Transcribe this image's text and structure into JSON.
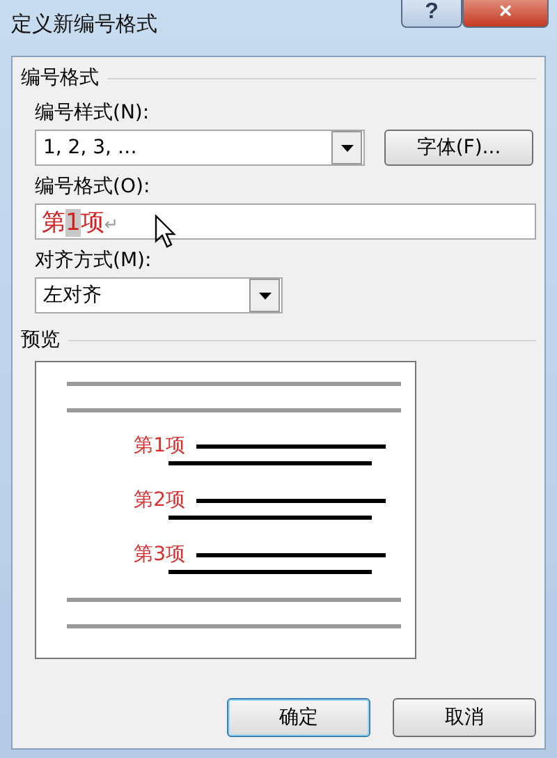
{
  "window": {
    "title": "定义新编号格式",
    "help_button": "?",
    "close_button": "×"
  },
  "number_format_group": {
    "title": "编号格式",
    "number_style": {
      "label": "编号样式(N):",
      "value": "1, 2, 3, …"
    },
    "font_button": "字体(F)...",
    "format_field": {
      "label": "编号格式(O):",
      "parts": [
        {
          "text": "第",
          "highlighted": false
        },
        {
          "text": "1",
          "highlighted": true
        },
        {
          "text": "项",
          "highlighted": false
        }
      ],
      "paragraph_mark": "↵"
    },
    "alignment": {
      "label": "对齐方式(M):",
      "value": "左对齐"
    }
  },
  "preview": {
    "title": "预览",
    "items": [
      {
        "label": "第1项"
      },
      {
        "label": "第2项"
      },
      {
        "label": "第3项"
      }
    ]
  },
  "buttons": [
    "确定",
    "取消"
  ]
}
